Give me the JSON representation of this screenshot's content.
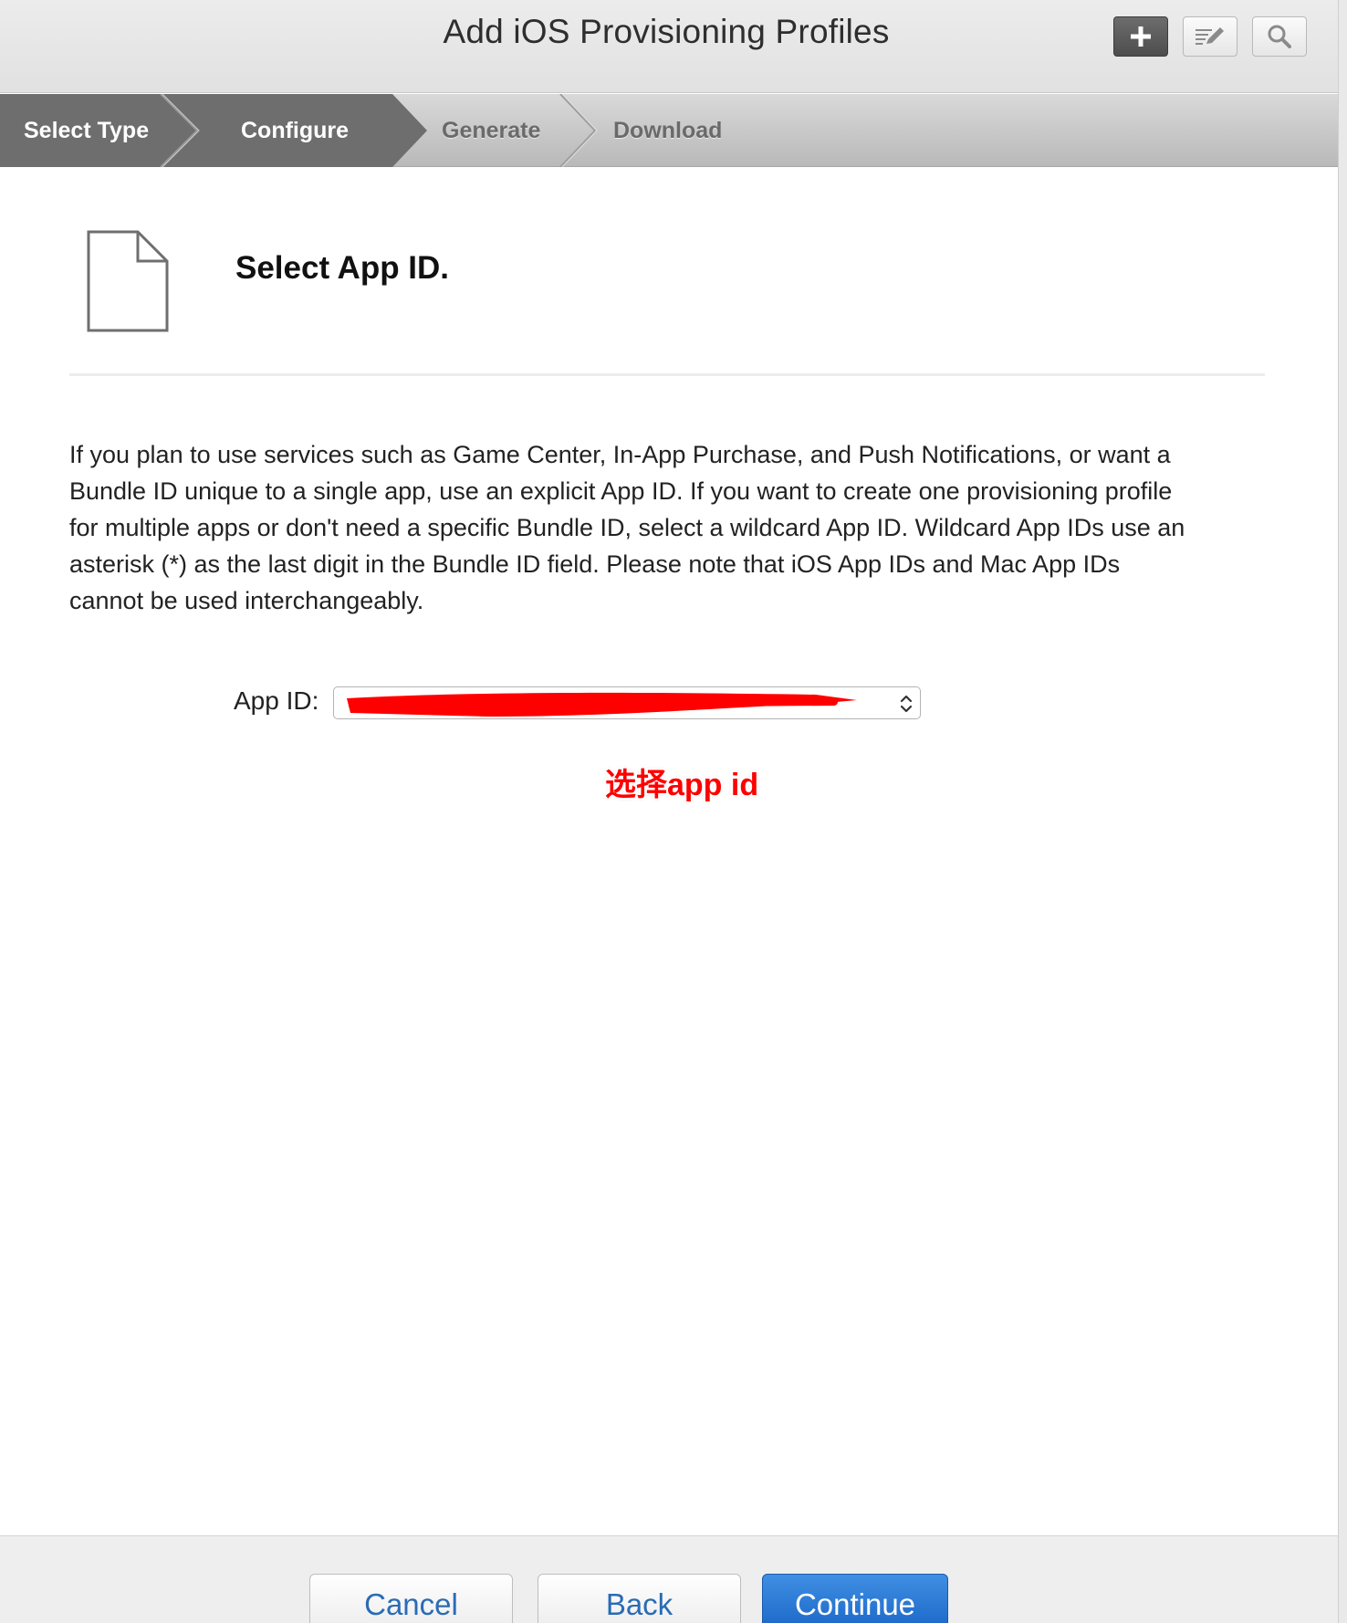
{
  "header": {
    "title": "Add iOS Provisioning Profiles",
    "tools": [
      {
        "name": "add",
        "icon": "plus-icon"
      },
      {
        "name": "edit",
        "icon": "edit-list-icon"
      },
      {
        "name": "search",
        "icon": "search-icon"
      }
    ]
  },
  "steps": [
    {
      "label": "Select Type",
      "state": "completed"
    },
    {
      "label": "Configure",
      "state": "current"
    },
    {
      "label": "Generate",
      "state": "upcoming"
    },
    {
      "label": "Download",
      "state": "upcoming"
    }
  ],
  "section": {
    "icon": "document-icon",
    "title": "Select App ID.",
    "description": "If you plan to use services such as Game Center, In-App Purchase, and Push Notifications, or want a Bundle ID unique to a single app, use an explicit App ID. If you want to create one provisioning profile for multiple apps or don't need a specific Bundle ID, select a wildcard App ID. Wildcard App IDs use an asterisk (*) as the last digit in the Bundle ID field. Please note that iOS App IDs and Mac App IDs cannot be used interchangeably."
  },
  "app_id": {
    "label": "App ID:",
    "value_redacted": true,
    "redaction_color": "#ff0000"
  },
  "annotation": {
    "text": "选择app id",
    "color": "#ff0000"
  },
  "footer": {
    "cancel_label": "Cancel",
    "back_label": "Back",
    "continue_label": "Continue"
  },
  "colors": {
    "accent": "#1b66c7",
    "step_active": "#6e6e6e",
    "link_text": "#2a6bb5"
  }
}
